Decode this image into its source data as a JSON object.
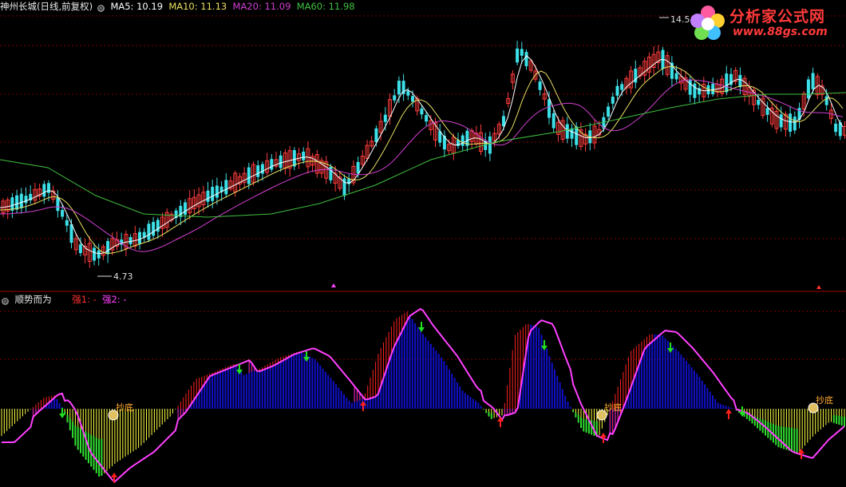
{
  "colors": {
    "ma5": "#ffffff",
    "ma10": "#e8e060",
    "ma20": "#d040d0",
    "ma60": "#40c040",
    "up": "#ff3c3c",
    "down": "#3ce0e8",
    "bar_red": "#ff2020",
    "bar_blue": "#1010c8",
    "bar_green": "#30e030",
    "bar_yellow": "#ffff40",
    "line_pink": "#ff40ff",
    "grid": "#7a0000"
  },
  "main": {
    "title": "神州长城(日线,前复权)",
    "ma5_label": "MA5: 10.19",
    "ma10_label": "MA10: 11.13",
    "ma20_label": "MA20: 11.09",
    "ma60_label": "MA60: 11.98",
    "low_marker": "4.73",
    "high_marker": "14.5"
  },
  "indicator": {
    "title": "顺势而为",
    "strong1": "强1: -",
    "strong2": "强2: -",
    "annotations": [
      "抄底",
      "抄底",
      "抄底"
    ]
  },
  "logo": {
    "title": "分析家公式网",
    "url": "www.88gs.com"
  },
  "chart_data": [
    {
      "type": "candlestick",
      "title": "神州长城(日线,前复权)",
      "series": [
        {
          "name": "MA5",
          "value": 10.19
        },
        {
          "name": "MA10",
          "value": 11.13
        },
        {
          "name": "MA20",
          "value": 11.09
        },
        {
          "name": "MA60",
          "value": 11.98
        }
      ],
      "annotations": [
        {
          "text": "4.73",
          "kind": "low"
        },
        {
          "text": "14.5",
          "kind": "high"
        }
      ],
      "grid": true
    },
    {
      "type": "bar",
      "title": "顺势而为",
      "series": [
        {
          "name": "强1",
          "value": "-"
        },
        {
          "name": "强2",
          "value": "-"
        }
      ],
      "grid": true
    }
  ]
}
